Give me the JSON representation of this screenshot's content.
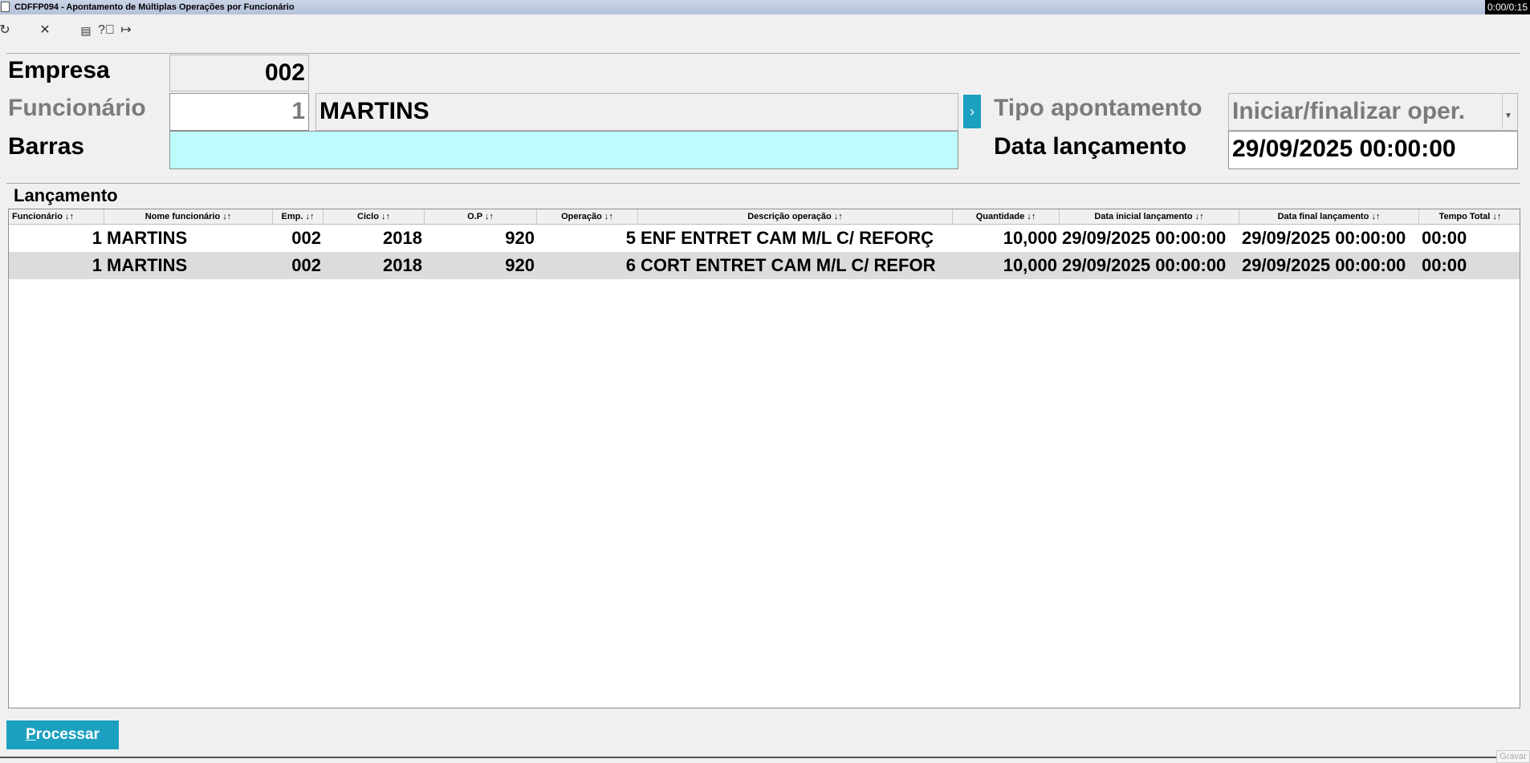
{
  "window": {
    "title": "CDFFP094 - Apontamento de Múltiplas Operações por Funcionário",
    "timer": "0:00/0:15"
  },
  "toolbar": {
    "icons": [
      "refresh-icon",
      "close-icon",
      "calendar-icon",
      "help-icon",
      "exit-icon"
    ]
  },
  "form": {
    "empresa_label": "Empresa",
    "empresa_value": "002",
    "funcionario_label": "Funcionário",
    "funcionario_code": "1",
    "funcionario_name": "MARTINS",
    "barras_label": "Barras",
    "barras_value": "",
    "tipo_label": "Tipo apontamento",
    "tipo_value": "Iniciar/finalizar oper.",
    "data_label": "Data lançamento",
    "data_value": "29/09/2025 00:00:00"
  },
  "grid": {
    "group_title": "Lançamento",
    "columns": [
      "Funcionário ↓↑",
      "Nome funcionário ↓↑",
      "Emp. ↓↑",
      "Ciclo ↓↑",
      "O.P ↓↑",
      "Operação ↓↑",
      "Descrição operação ↓↑",
      "Quantidade ↓↑",
      "Data inicial lançamento ↓↑",
      "Data final lançamento ↓↑",
      "Tempo Total ↓↑"
    ],
    "rows": [
      [
        "1",
        "MARTINS",
        "002",
        "2018",
        "920",
        "5",
        "ENF ENTRET CAM M/L C/ REFORÇ",
        "10,000",
        "29/09/2025 00:00:00",
        "29/09/2025 00:00:00",
        "00:00"
      ],
      [
        "1",
        "MARTINS",
        "002",
        "2018",
        "920",
        "6",
        "CORT ENTRET CAM M/L C/ REFOR",
        "10,000",
        "29/09/2025 00:00:00",
        "29/09/2025 00:00:00",
        "00:00"
      ]
    ]
  },
  "actions": {
    "processar_first": "P",
    "processar_rest": "rocessar"
  },
  "status": {
    "corner_text": "Gravar"
  }
}
